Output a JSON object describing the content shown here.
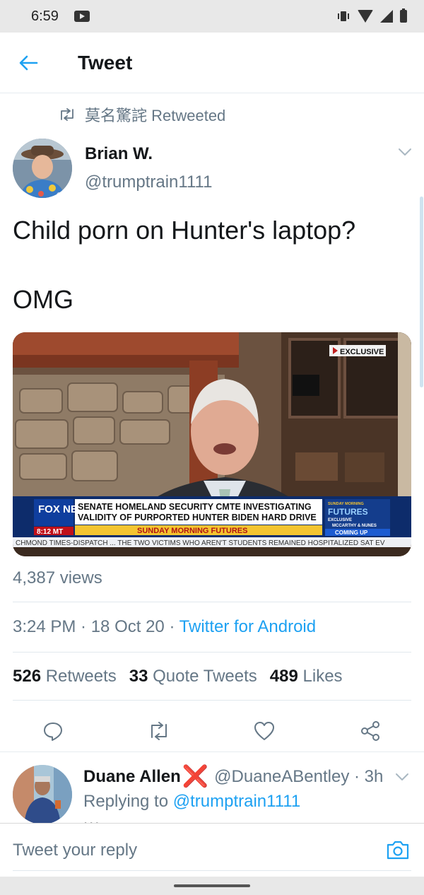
{
  "status_bar": {
    "time": "6:59"
  },
  "header": {
    "title": "Tweet"
  },
  "retweet_context": {
    "text": "莫名驚詫 Retweeted"
  },
  "tweet": {
    "author_name": "Brian W.",
    "author_handle": "@trumptrain1111",
    "text_line1": "Child porn on Hunter's laptop?",
    "text_line2": "OMG",
    "views": "4,387 views",
    "time": "3:24 PM · 18 Oct 20 · ",
    "source": "Twitter for Android",
    "stats": {
      "retweets_count": "526",
      "retweets_label": "Retweets",
      "quotes_count": "33",
      "quotes_label": "Quote Tweets",
      "likes_count": "489",
      "likes_label": "Likes"
    },
    "media": {
      "exclusive_label": "EXCLUSIVE",
      "headline_line1": "SENATE HOMELAND SECURITY CMTE INVESTIGATING",
      "headline_line2": "VALIDITY OF PURPORTED HUNTER BIDEN HARD DRIVE",
      "show_name": "SUNDAY MORNING FUTURES",
      "ticker": "CHMOND TIMES-DISPATCH ... THE TWO VICTIMS WHO AREN'T STUDENTS REMAINED HOSPITALIZED SAT EV",
      "channel_logo": "FOX NEWS",
      "clock": "8:12 MT",
      "promo_title": "FUTURES",
      "promo_sub": "EXCLUSIVE",
      "promo_names": "MCCARTHY & NUNES",
      "promo_coming": "COMING UP",
      "promo_sunday": "SUNDAY MORNING"
    }
  },
  "reply": {
    "name": "Duane Allen",
    "badge": "❌",
    "handle_time": "@DuaneABentley · 3h",
    "replying_prefix": "Replying to ",
    "replying_mention": "@trumptrain1111",
    "text_partial": "..."
  },
  "composer": {
    "placeholder": "Tweet your reply"
  },
  "colors": {
    "accent": "#1da1f2",
    "secondary_text": "#657786",
    "primary_text": "#14171a",
    "reply_badge": "#e0245e"
  }
}
